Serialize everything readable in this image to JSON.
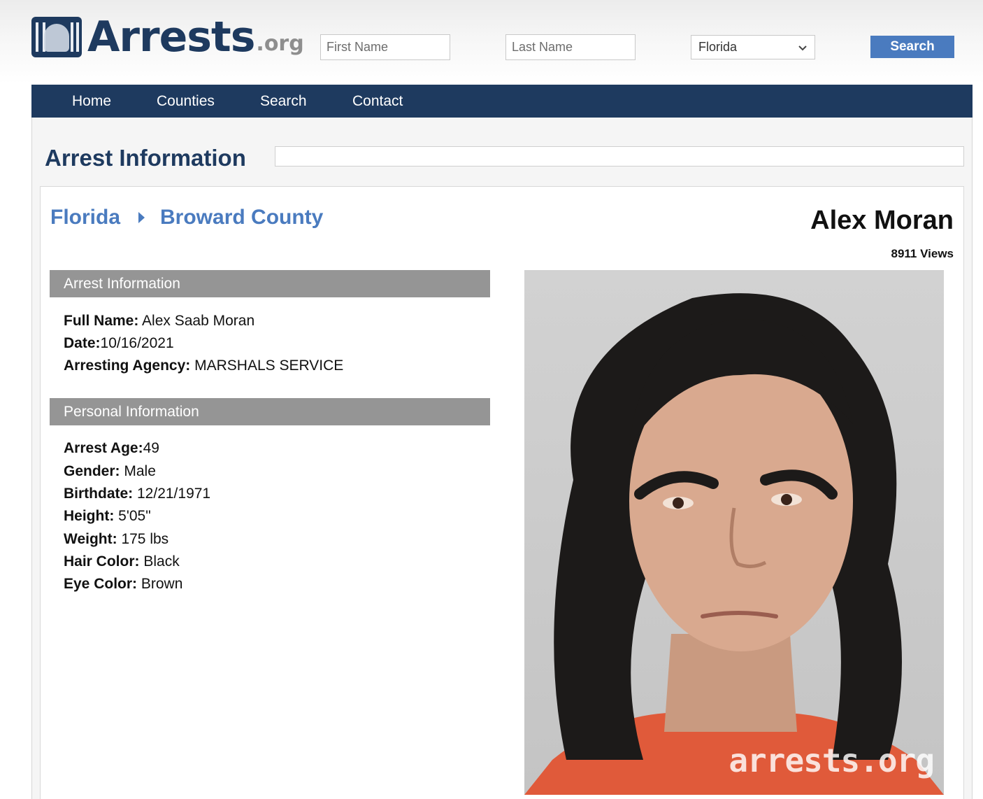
{
  "header": {
    "logo_word": "Arrests",
    "logo_suffix": ".org",
    "first_name_placeholder": "First Name",
    "last_name_placeholder": "Last Name",
    "state_selected": "Florida",
    "search_label": "Search"
  },
  "nav": {
    "items": [
      "Home",
      "Counties",
      "Search",
      "Contact"
    ]
  },
  "page": {
    "heading": "Arrest Information"
  },
  "breadcrumb": {
    "state": "Florida",
    "county": "Broward County"
  },
  "person": {
    "name": "Alex Moran",
    "views": "8911 Views"
  },
  "arrest_info": {
    "title": "Arrest Information",
    "fields": [
      {
        "label": "Full Name:",
        "value": " Alex Saab Moran"
      },
      {
        "label": "Date:",
        "value": "10/16/2021"
      },
      {
        "label": "Arresting Agency:",
        "value": " MARSHALS SERVICE"
      }
    ]
  },
  "personal_info": {
    "title": "Personal Information",
    "fields": [
      {
        "label": "Arrest Age:",
        "value": "49"
      },
      {
        "label": "Gender:",
        "value": " Male"
      },
      {
        "label": "Birthdate:",
        "value": " 12/21/1971"
      },
      {
        "label": "Height:",
        "value": " 5'05\""
      },
      {
        "label": "Weight:",
        "value": " 175 lbs"
      },
      {
        "label": "Hair Color:",
        "value": " Black"
      },
      {
        "label": "Eye Color:",
        "value": " Brown"
      }
    ]
  },
  "mugshot": {
    "watermark": "arrests.org"
  },
  "colors": {
    "navy": "#1e3a5f",
    "link_blue": "#4a7bbf",
    "section_gray": "#959595"
  }
}
